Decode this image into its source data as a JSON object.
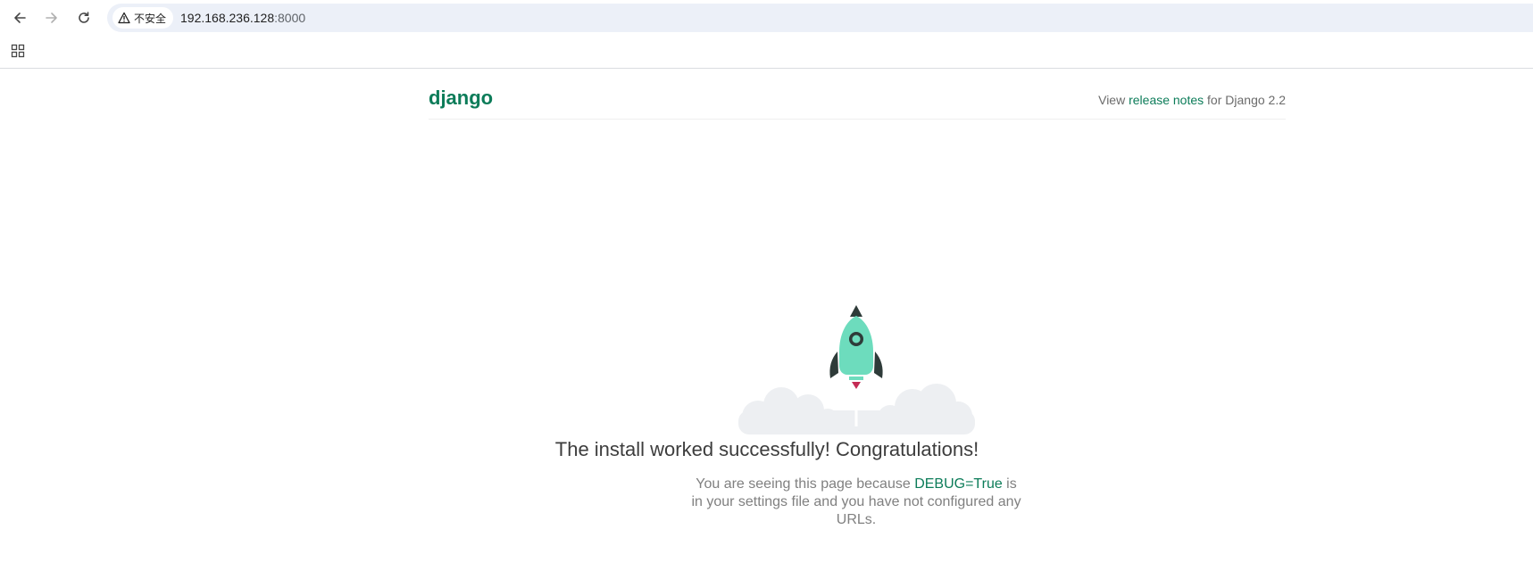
{
  "browser": {
    "security_label": "不安全",
    "url_host": "192.168.236.128",
    "url_port": ":8000"
  },
  "header": {
    "logo": "django",
    "release_prefix": "View ",
    "release_link": "release notes",
    "release_suffix": " for Django 2.2"
  },
  "main": {
    "title": "The install worked successfully! Congratulations!",
    "sub_before": "You are seeing this page because ",
    "sub_debug": "DEBUG=True",
    "sub_after": " is in your settings file and you have not configured any URLs."
  },
  "colors": {
    "accent": "#0c7c59",
    "rocket_body": "#6ddcbd",
    "rocket_dark": "#2e3b39",
    "flame": "#c42b54",
    "cloud": "#edeff2"
  },
  "icons": [
    "back-arrow-icon",
    "forward-arrow-icon",
    "reload-icon",
    "warning-icon",
    "apps-grid-icon",
    "rocket-icon"
  ]
}
